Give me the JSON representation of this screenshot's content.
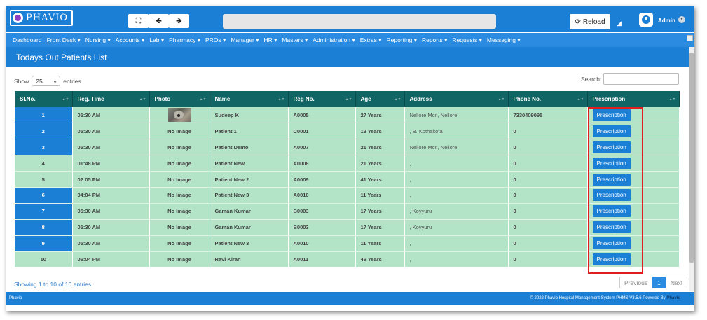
{
  "app": {
    "logo_text": "PHAVIO",
    "reload_label": "Reload",
    "user": "Admin"
  },
  "nav": [
    "Dashboard",
    "Front Desk ▾",
    "Nursing ▾",
    "Accounts ▾",
    "Lab ▾",
    "Pharmacy ▾",
    "PROs ▾",
    "Manager ▾",
    "HR ▾",
    "Masters ▾",
    "Administration ▾",
    "Extras ▾",
    "Reporting ▾",
    "Reports ▾",
    "Requests ▾",
    "Messaging ▾"
  ],
  "page": {
    "title": "Todays Out Patients List"
  },
  "controls": {
    "show_label": "Show",
    "entries_value": "25",
    "entries_label": "entries",
    "search_label": "Search:"
  },
  "table": {
    "headers": [
      "Sl.No.",
      "Reg. Time",
      "Photo",
      "Name",
      "Reg No.",
      "Age",
      "Address",
      "Phone No.",
      "Prescription"
    ],
    "rows": [
      {
        "sl": "1",
        "time": "05:30 AM",
        "photo": "",
        "name": "Sudeep K",
        "reg": "A0005",
        "age": "27 Years",
        "address": "Nellore Mcn, Nellore",
        "phone": "7330409095",
        "action": "Prescription"
      },
      {
        "sl": "2",
        "time": "05:30 AM",
        "photo": "No Image",
        "name": "Patient 1",
        "reg": "C0001",
        "age": "19 Years",
        "address": ", B. Kothakota",
        "phone": "0",
        "action": "Prescription"
      },
      {
        "sl": "3",
        "time": "05:30 AM",
        "photo": "No Image",
        "name": "Patient Demo",
        "reg": "A0007",
        "age": "21 Years",
        "address": "Nellore Mcn, Nellore",
        "phone": "0",
        "action": "Prescription"
      },
      {
        "sl": "4",
        "time": "01:48 PM",
        "photo": "No Image",
        "name": "Patient New",
        "reg": "A0008",
        "age": "21 Years",
        "address": ",",
        "phone": "0",
        "action": "Prescription"
      },
      {
        "sl": "5",
        "time": "02:05 PM",
        "photo": "No Image",
        "name": "Patient New 2",
        "reg": "A0009",
        "age": "41 Years",
        "address": ",",
        "phone": "0",
        "action": "Prescription"
      },
      {
        "sl": "6",
        "time": "04:04 PM",
        "photo": "No Image",
        "name": "Patient New 3",
        "reg": "A0010",
        "age": "11 Years",
        "address": ",",
        "phone": "0",
        "action": "Prescription"
      },
      {
        "sl": "7",
        "time": "05:30 AM",
        "photo": "No Image",
        "name": "Gaman Kumar",
        "reg": "B0003",
        "age": "17 Years",
        "address": ", Koyyuru",
        "phone": "0",
        "action": "Prescription"
      },
      {
        "sl": "8",
        "time": "05:30 AM",
        "photo": "No Image",
        "name": "Gaman Kumar",
        "reg": "B0003",
        "age": "17 Years",
        "address": ", Koyyuru",
        "phone": "0",
        "action": "Prescription"
      },
      {
        "sl": "9",
        "time": "05:30 AM",
        "photo": "No Image",
        "name": "Patient New 3",
        "reg": "A0010",
        "age": "11 Years",
        "address": ",",
        "phone": "0",
        "action": "Prescription"
      },
      {
        "sl": "10",
        "time": "06:04 PM",
        "photo": "No Image",
        "name": "Ravi Kiran",
        "reg": "A0011",
        "age": "46 Years",
        "address": ",",
        "phone": "0",
        "action": "Prescription"
      }
    ]
  },
  "pagination": {
    "info": "Showing 1 to 10 of 10 entries",
    "previous": "Previous",
    "current": "1",
    "next": "Next"
  },
  "footer": {
    "left": "Phavio",
    "right": "© 2022 Phavio Hospital Management System PHMS V3.5.6 Powered By",
    "right_brand": "Phavio"
  },
  "colors": {
    "primary": "#1c7fd6",
    "header_teal": "#126565",
    "row_green": "#b4e4c8",
    "highlight": "#e01e1e"
  },
  "icons": {
    "fullscreen": "expand-icon",
    "back": "arrow-left-icon",
    "forward": "arrow-right-icon",
    "reload": "refresh-icon",
    "user": "user-icon"
  }
}
